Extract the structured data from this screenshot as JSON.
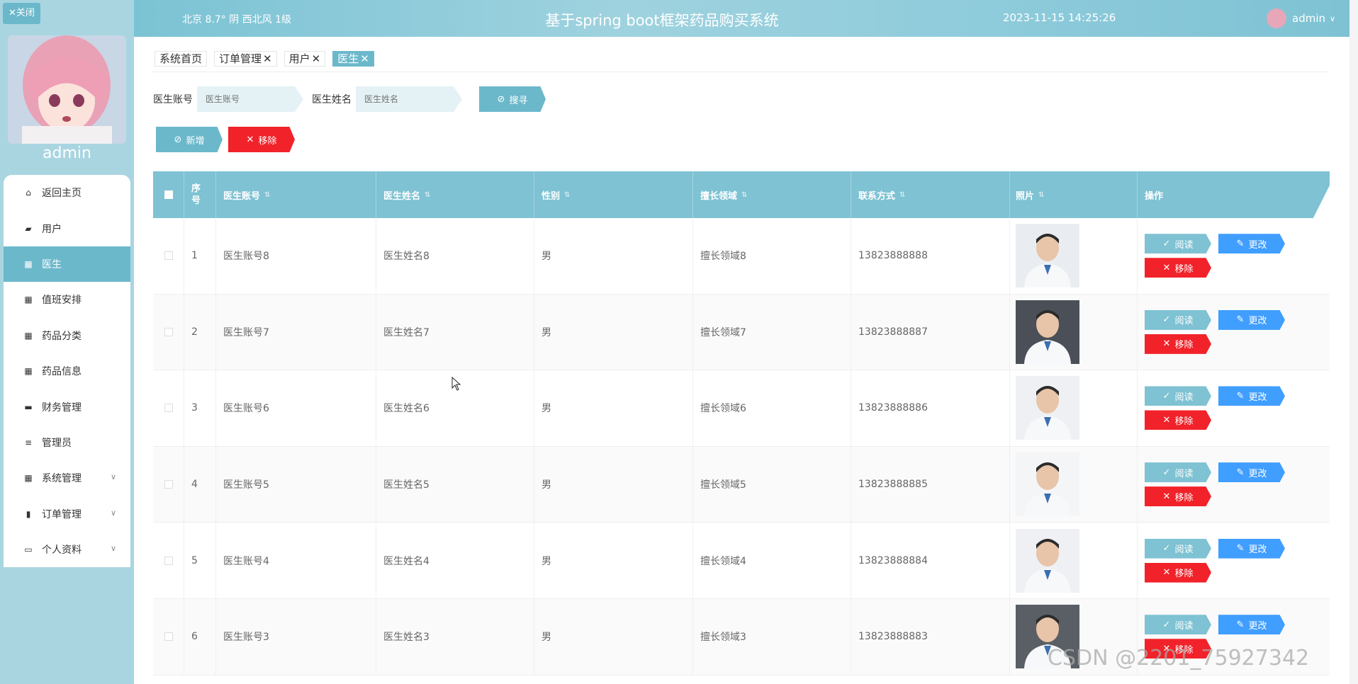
{
  "sidebar": {
    "close_label": "✕关闭",
    "username": "admin",
    "items": [
      {
        "label": "返回主页",
        "icon": "home-icon"
      },
      {
        "label": "用户",
        "icon": "user-card-icon"
      },
      {
        "label": "医生",
        "icon": "grid-icon"
      },
      {
        "label": "值班安排",
        "icon": "grid-icon"
      },
      {
        "label": "药品分类",
        "icon": "grid-icon"
      },
      {
        "label": "药品信息",
        "icon": "grid-icon"
      },
      {
        "label": "财务管理",
        "icon": "wallet-icon"
      },
      {
        "label": "管理员",
        "icon": "list-icon"
      },
      {
        "label": "系统管理",
        "icon": "grid-icon"
      },
      {
        "label": "订单管理",
        "icon": "chart-icon"
      },
      {
        "label": "个人资料",
        "icon": "card-icon"
      }
    ]
  },
  "header": {
    "weather": "北京  8.7°  阴  西北风  1级",
    "title": "基于spring boot框架药品购买系统",
    "datetime": "2023-11-15 14:25:26",
    "user": "admin"
  },
  "tabs": [
    {
      "label": "系统首页",
      "closable": false
    },
    {
      "label": "订单管理",
      "closable": true
    },
    {
      "label": "用户",
      "closable": true
    },
    {
      "label": "医生",
      "closable": true,
      "active": true
    }
  ],
  "search": {
    "account_label": "医生账号",
    "account_placeholder": "医生账号",
    "name_label": "医生姓名",
    "name_placeholder": "医生姓名",
    "search_button": "搜寻"
  },
  "actions": {
    "add": "新增",
    "remove": "移除"
  },
  "table": {
    "headers": [
      "序号",
      "医生账号",
      "医生姓名",
      "性别",
      "擅长领域",
      "联系方式",
      "照片",
      "操作"
    ],
    "ops": {
      "read": "阅读",
      "edit": "更改",
      "del": "移除"
    },
    "rows": [
      {
        "no": "1",
        "account": "医生账号8",
        "name": "医生姓名8",
        "gender": "男",
        "field": "擅长领域8",
        "phone": "13823888888"
      },
      {
        "no": "2",
        "account": "医生账号7",
        "name": "医生姓名7",
        "gender": "男",
        "field": "擅长领域7",
        "phone": "13823888887"
      },
      {
        "no": "3",
        "account": "医生账号6",
        "name": "医生姓名6",
        "gender": "男",
        "field": "擅长领域6",
        "phone": "13823888886"
      },
      {
        "no": "4",
        "account": "医生账号5",
        "name": "医生姓名5",
        "gender": "男",
        "field": "擅长领域5",
        "phone": "13823888885"
      },
      {
        "no": "5",
        "account": "医生账号4",
        "name": "医生姓名4",
        "gender": "男",
        "field": "擅长领域4",
        "phone": "13823888884"
      },
      {
        "no": "6",
        "account": "医生账号3",
        "name": "医生姓名3",
        "gender": "男",
        "field": "擅长领域3",
        "phone": "13823888883"
      }
    ]
  },
  "watermark": "CSDN @2201_75927342",
  "colors": {
    "accent": "#6cb8cb",
    "header": "#7ec2d3",
    "danger": "#f2222a",
    "edit": "#409eff"
  }
}
